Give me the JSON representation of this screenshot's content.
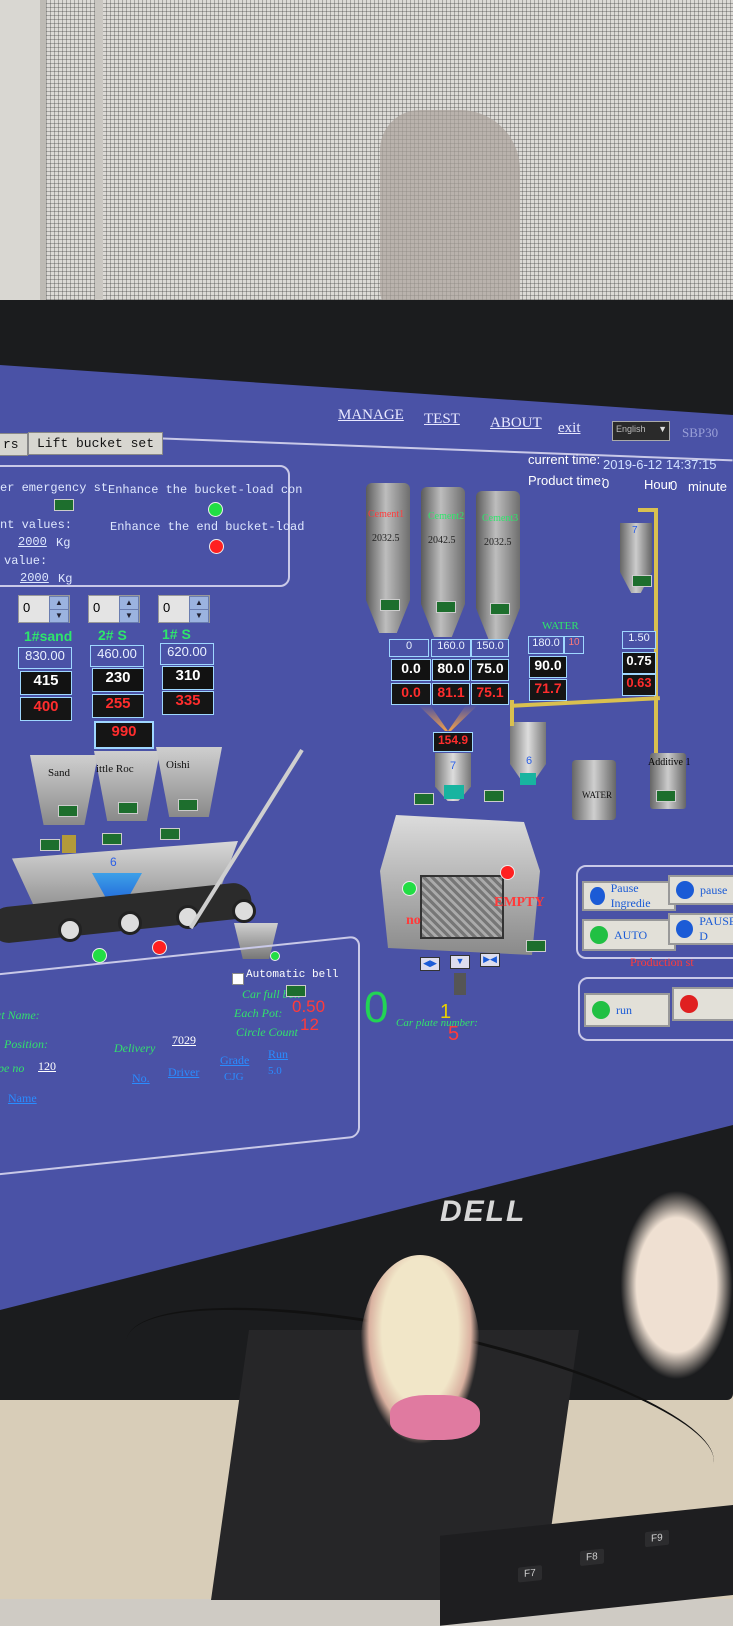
{
  "menu": {
    "manage": "MANAGE",
    "test": "TEST",
    "about": "ABOUT",
    "exit": "exit",
    "language_value": "English",
    "version": "SBP30"
  },
  "tabs": {
    "partial_tab": "rs",
    "lift_bucket": "Lift bucket set"
  },
  "header": {
    "current_time_label": "current time:",
    "current_time_value": "2019-6-12  14:37:15",
    "product_time_label": "Product time:",
    "product_time_value": "0",
    "hour_label": "Hour",
    "hour_value": "0",
    "minute_label": "minute"
  },
  "settings_panel": {
    "emergency": "er emergency st",
    "enhance_bucket": "Enhance the bucket-load con",
    "values_label": "nt values:",
    "enhance_end": "Enhance the end bucket-load",
    "value1": "2000",
    "unit1": "Kg",
    "value_label": "value:",
    "value2": "2000",
    "unit2": "Kg"
  },
  "aggregates": {
    "steppers": [
      "0",
      "0",
      "0"
    ],
    "items": [
      {
        "name": "1#sand",
        "set": "830.00",
        "target": "415",
        "actual": "400",
        "hopper": "Sand"
      },
      {
        "name": "2# S",
        "set": "460.00",
        "target": "230",
        "actual": "255",
        "hopper": "ittle Roc"
      },
      {
        "name": "1# S",
        "set": "620.00",
        "target": "310",
        "actual": "335",
        "hopper": "Oishi"
      }
    ],
    "total": "990",
    "belt_label": "6"
  },
  "cement": {
    "silos": [
      {
        "name": "Cement1",
        "value": "2032.5"
      },
      {
        "name": "Cement2",
        "value": "2042.5"
      },
      {
        "name": "Cement3",
        "value": "2032.5"
      }
    ],
    "set_values": [
      "0",
      "160.0",
      "150.0"
    ],
    "targets": [
      "0.0",
      "80.0",
      "75.0"
    ],
    "actuals": [
      "0.0",
      "81.1",
      "75.1"
    ],
    "scale_value": "154.9",
    "scale_label": "7"
  },
  "water": {
    "label": "WATER",
    "set": "180.0",
    "extra": "10",
    "target": "90.0",
    "actual": "71.7",
    "tank_label": "WATER",
    "scale_label": "6"
  },
  "additive": {
    "set": "1.50",
    "target": "0.75",
    "actual": "0.63",
    "silo_label": "7",
    "tank_label": "Additive 1"
  },
  "mixer": {
    "left_label": "no",
    "right_label": "EMPTY"
  },
  "production_panel": {
    "pause_ingredient": "Pause Ingredie",
    "pause": "pause",
    "auto": "AUTO",
    "pause_d": "PAUSE D",
    "production_status": "Production st",
    "run": "run"
  },
  "bottom_panel": {
    "automatic_bell": "Automatic bell",
    "car_full_bell": "Car full bell",
    "each_pot_label": "Each Pot:",
    "each_pot_value": "0.50",
    "circle_count_label": "Circle Count",
    "circle_count_value": "12",
    "product_name_label": "ct Name:",
    "position_label": "Position:",
    "delivery_label": "Delivery",
    "delivery_value": "7029",
    "type_label": "pe no",
    "type_value": "120",
    "no_link": "No.",
    "driver_link": "Driver",
    "grade_link": "Grade",
    "run_link": "Run",
    "cjg_value": "CJG",
    "last_value": "5.0",
    "name_link": "Name",
    "big_zero": "0",
    "car_plate_label": "Car plate number:",
    "yellow_value": "1",
    "red_value": "5"
  },
  "hardware": {
    "brand": "DELL",
    "keys": [
      "F7",
      "F8",
      "F9"
    ]
  }
}
